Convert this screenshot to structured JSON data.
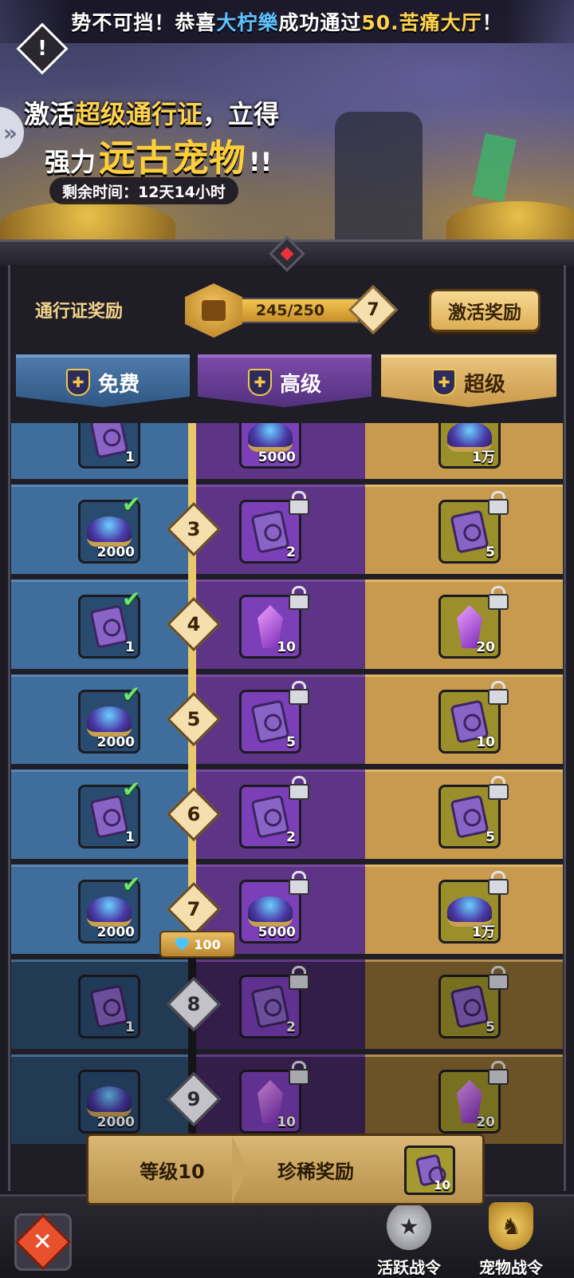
{
  "announcement": {
    "prefix": "势不可挡！恭喜",
    "player": "大柠樂",
    "middle": "成功通过",
    "stage": "50.苦痛大厅",
    "suffix": "！"
  },
  "warning_icon": "!",
  "promo": {
    "line1_pre": "激活",
    "line1_hl": "超级通行证",
    "line1_post": "，立得",
    "line2_pre": "强力",
    "line2_big": "远古宠物",
    "line2_post": "!!",
    "timer": "剩余时间：12天14小时"
  },
  "pass": {
    "label": "通行证奖励",
    "xp_text": "245/250",
    "xp_fraction": 0.98,
    "level": "7",
    "activate_label": "激活奖励"
  },
  "tabs": {
    "free": "免费",
    "advanced": "高级",
    "super": "超级"
  },
  "rows": [
    {
      "level": "",
      "free": {
        "icon": "scroll",
        "qty": "1",
        "state": "claimed"
      },
      "adv": {
        "icon": "dust",
        "qty": "5000"
      },
      "sup": {
        "icon": "dust",
        "qty": "1万"
      }
    },
    {
      "level": "3",
      "free": {
        "icon": "dust",
        "qty": "2000",
        "state": "claimed"
      },
      "adv": {
        "icon": "scroll",
        "qty": "2"
      },
      "sup": {
        "icon": "scroll",
        "qty": "5"
      }
    },
    {
      "level": "4",
      "free": {
        "icon": "scroll",
        "qty": "1",
        "state": "claimed"
      },
      "adv": {
        "icon": "crystal",
        "qty": "10"
      },
      "sup": {
        "icon": "crystal",
        "qty": "20"
      }
    },
    {
      "level": "5",
      "free": {
        "icon": "dust",
        "qty": "2000",
        "state": "claimed"
      },
      "adv": {
        "icon": "scroll",
        "qty": "5"
      },
      "sup": {
        "icon": "scroll",
        "qty": "10"
      }
    },
    {
      "level": "6",
      "free": {
        "icon": "scroll",
        "qty": "1",
        "state": "claimed"
      },
      "adv": {
        "icon": "scroll",
        "qty": "2"
      },
      "sup": {
        "icon": "scroll",
        "qty": "5"
      }
    },
    {
      "level": "7",
      "free": {
        "icon": "dust",
        "qty": "2000",
        "state": "claimed"
      },
      "adv": {
        "icon": "dust",
        "qty": "5000"
      },
      "sup": {
        "icon": "dust",
        "qty": "1万"
      }
    },
    {
      "level": "8",
      "free": {
        "icon": "scroll",
        "qty": "1",
        "state": "locked"
      },
      "adv": {
        "icon": "scroll",
        "qty": "2"
      },
      "sup": {
        "icon": "scroll",
        "qty": "5"
      }
    },
    {
      "level": "9",
      "free": {
        "icon": "dust",
        "qty": "2000",
        "state": "locked"
      },
      "adv": {
        "icon": "crystal",
        "qty": "10"
      },
      "sup": {
        "icon": "crystal",
        "qty": "20"
      }
    }
  ],
  "unlock_cost": "100",
  "next_reward": {
    "level_label": "等级10",
    "label": "珍稀奖励",
    "qty": "10"
  },
  "nav": {
    "close_icon": "✕",
    "activity_label": "活跃战令",
    "pet_label": "宠物战令"
  }
}
